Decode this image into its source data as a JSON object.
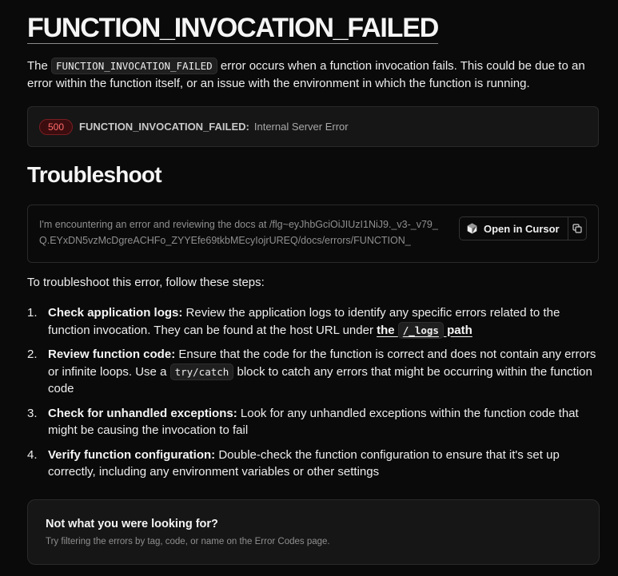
{
  "header": {
    "title": "FUNCTION_INVOCATION_FAILED"
  },
  "intro": {
    "before": "The ",
    "code": "FUNCTION_INVOCATION_FAILED",
    "after": " error occurs when a function invocation fails. This could be due to an error within the function itself, or an issue with the environment in which the function is running."
  },
  "error_box": {
    "status": "500",
    "code": "FUNCTION_INVOCATION_FAILED:",
    "message": "Internal Server Error"
  },
  "troubleshoot": {
    "heading": "Troubleshoot",
    "prompt": "I'm encountering an error and reviewing the docs at /flg~eyJhbGciOiJIUzI1NiJ9._v3-_v79_Q.EYxDN5vzMcDgreACHFo_ZYYEfe69tkbMEcyIojrUREQ/docs/errors/FUNCTION_",
    "open_cursor_label": "Open in Cursor",
    "icons": {
      "cursor": "cursor-logo-icon",
      "copy": "copy-icon"
    }
  },
  "steps_intro": "To troubleshoot this error, follow these steps:",
  "steps": [
    {
      "num": "1.",
      "title": "Check application logs:",
      "text": " Review the application logs to identify any specific errors related to the function invocation. They can be found at the host URL under ",
      "link_before": "the ",
      "link_code": "/_logs",
      "link_after": " path"
    },
    {
      "num": "2.",
      "title": "Review function code:",
      "text_before": " Ensure that the code for the function is correct and does not contain any errors or infinite loops. Use a ",
      "code": "try/catch",
      "text_after": " block to catch any errors that might be occurring within the function code"
    },
    {
      "num": "3.",
      "title": "Check for unhandled exceptions:",
      "text": " Look for any unhandled exceptions within the function code that might be causing the invocation to fail"
    },
    {
      "num": "4.",
      "title": "Verify function configuration:",
      "text": " Double-check the function configuration to ensure that it's set up correctly, including any environment variables or other settings"
    }
  ],
  "not_found": {
    "title": "Not what you were looking for?",
    "description": "Try filtering the errors by tag, code, or name on the Error Codes page."
  },
  "colors": {
    "background": "#0a0a0a",
    "badge_text": "#ff6b6b",
    "badge_bg": "#3b0d0f"
  }
}
